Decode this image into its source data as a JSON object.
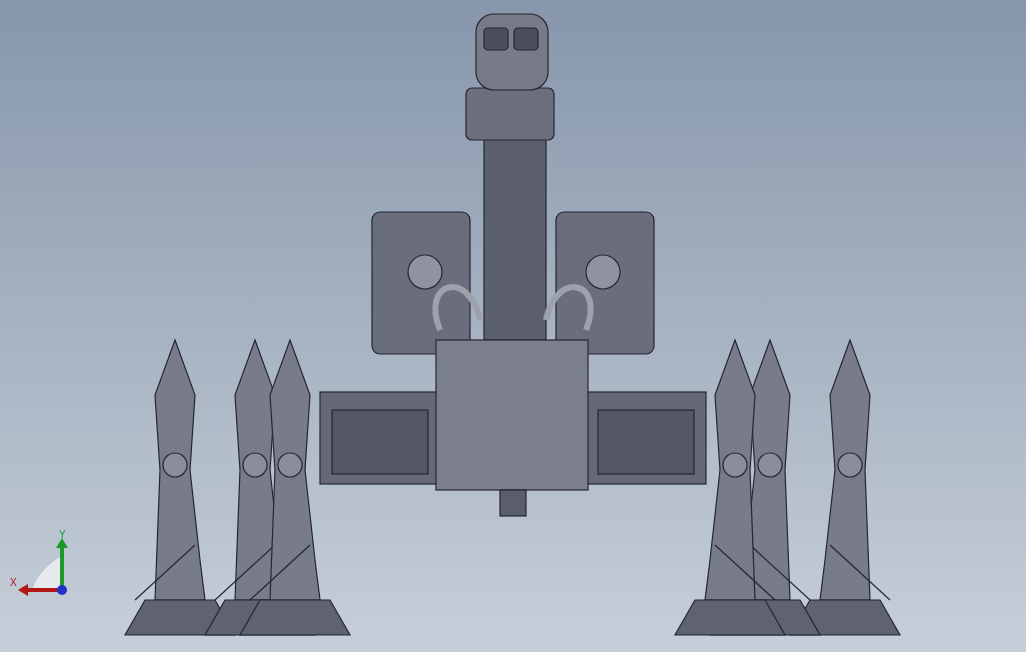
{
  "viewport": {
    "model": {
      "kind": "robot"
    },
    "triad": {
      "x_label": "X",
      "y_label": "Y"
    }
  }
}
